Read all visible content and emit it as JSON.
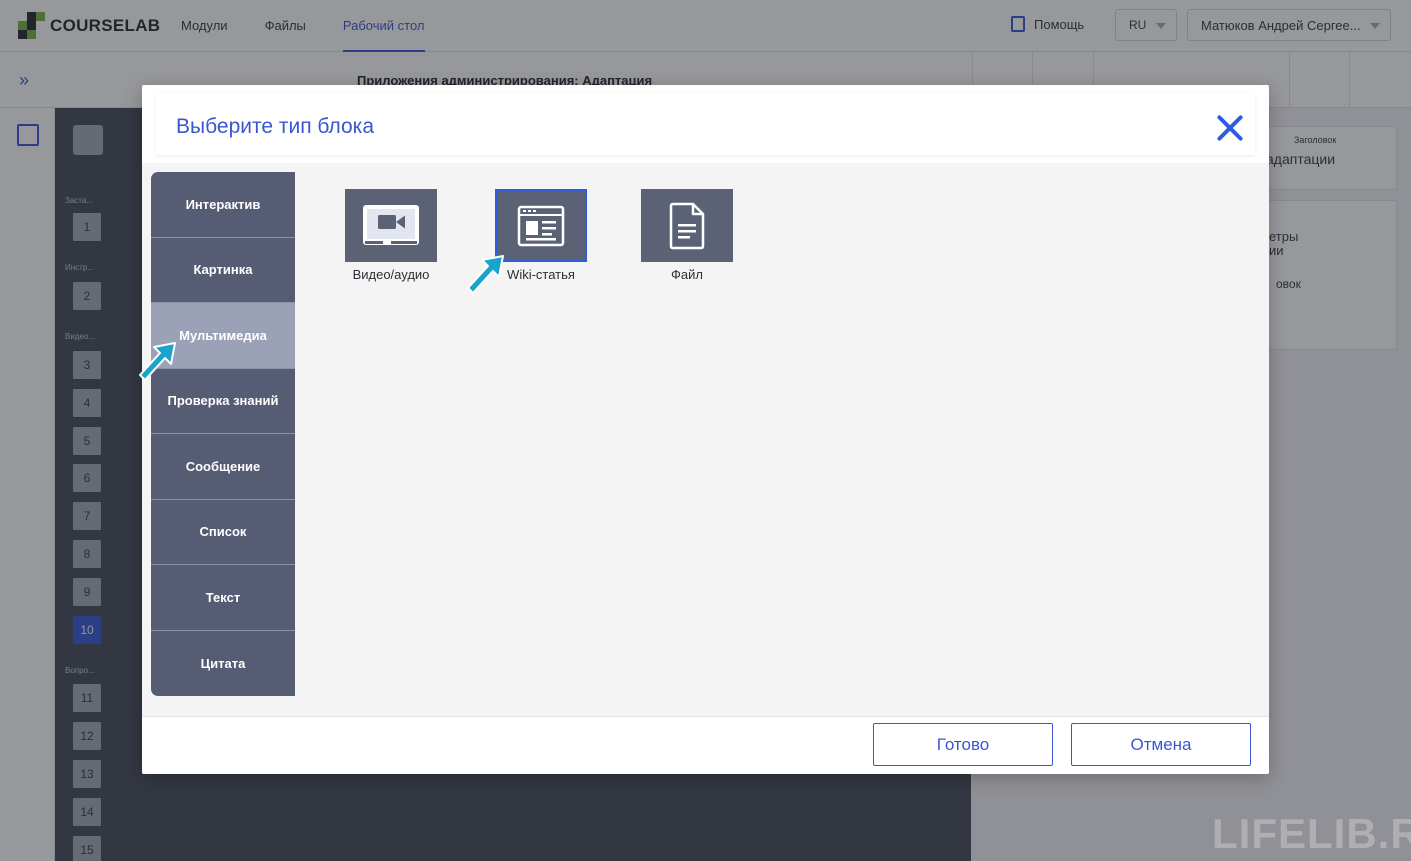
{
  "app": {
    "logo_text": "COURSELAB",
    "nav": [
      "Модули",
      "Файлы",
      "Рабочий стол"
    ],
    "active_nav": "Рабочий стол",
    "help_label": "Помощь",
    "language": "RU",
    "user_name": "Матюков Андрей Сергее..."
  },
  "editor": {
    "course_title": "Приложения администрирования: Адаптация",
    "sections": [
      "Заста...",
      "Инстр...",
      "Видео...",
      "Вопро..."
    ],
    "slides": [
      "1",
      "2",
      "3",
      "4",
      "5",
      "6",
      "7",
      "8",
      "9",
      "10",
      "11",
      "12",
      "13",
      "14",
      "15"
    ],
    "active_slide": "10",
    "right_panel": {
      "card_text": "адаптации",
      "card_badge": "Заголовок",
      "params_text": "етры",
      "params_text2": "ии",
      "label_text": "овок"
    }
  },
  "modal": {
    "title": "Выберите тип блока",
    "categories": [
      "Интерактив",
      "Картинка",
      "Мультимедиа",
      "Проверка знаний",
      "Сообщение",
      "Список",
      "Текст",
      "Цитата"
    ],
    "active_category": "Мультимедиа",
    "types": [
      {
        "label": "Видео/аудио",
        "icon": "video-icon"
      },
      {
        "label": "Wiki-статья",
        "icon": "wiki-article-icon"
      },
      {
        "label": "Файл",
        "icon": "file-icon"
      }
    ],
    "selected_type": "Wiki-статья",
    "done_label": "Готово",
    "cancel_label": "Отмена"
  },
  "watermark": "LIFELIB.RU",
  "colors": {
    "accent": "#3a57cf",
    "category_bg": "#565c73",
    "category_active": "#9ba1b6",
    "tile_bg": "#5c6275",
    "arrow": "#1aa4c9"
  }
}
